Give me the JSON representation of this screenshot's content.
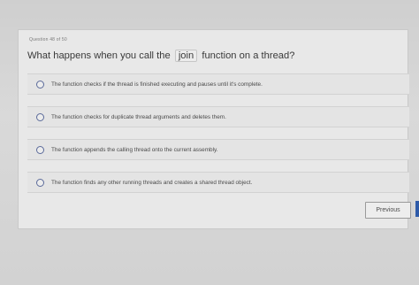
{
  "question": {
    "number_label": "Question 48 of 50",
    "text_before": "What happens when you call the",
    "keyword": "join",
    "text_after": "function on a thread?"
  },
  "options": [
    {
      "label": "The function checks if the thread is finished executing and pauses until it's complete."
    },
    {
      "label": "The function checks for duplicate thread arguments and deletes them."
    },
    {
      "label": "The function appends the calling thread onto the current assembly."
    },
    {
      "label": "The function finds any other running threads and creates a shared thread object."
    }
  ],
  "nav": {
    "previous_label": "Previous"
  }
}
